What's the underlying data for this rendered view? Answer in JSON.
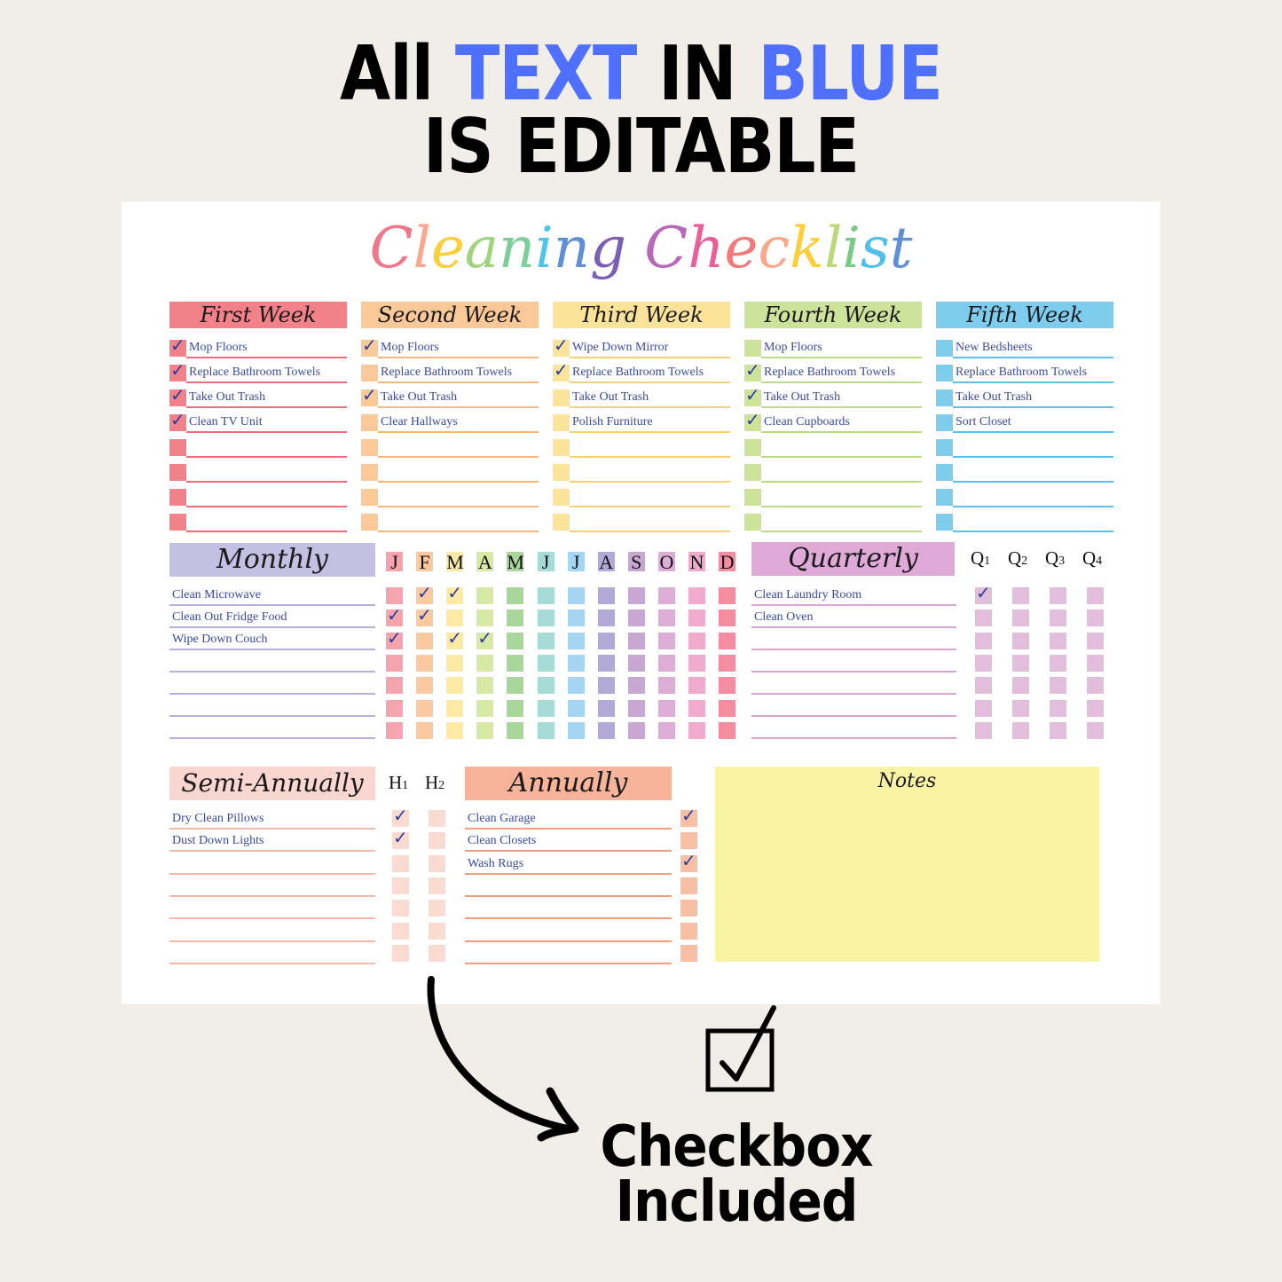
{
  "banner": {
    "line1_pre": "All ",
    "line1_blue1": "TEXT",
    "line1_mid": " IN ",
    "line1_blue2": "BLUE",
    "line2": "IS EDITABLE"
  },
  "title": "Cleaning Checklist",
  "weeks": [
    {
      "title": "First Week",
      "color": "#f2818a",
      "line": "#ee6f7a",
      "items": [
        {
          "text": "Mop Floors",
          "checked": true
        },
        {
          "text": "Replace Bathroom Towels",
          "checked": true
        },
        {
          "text": "Take Out Trash",
          "checked": true
        },
        {
          "text": "Clean TV Unit",
          "checked": true
        },
        {
          "text": "",
          "checked": false
        },
        {
          "text": "",
          "checked": false
        },
        {
          "text": "",
          "checked": false
        },
        {
          "text": "",
          "checked": false
        }
      ]
    },
    {
      "title": "Second Week",
      "color": "#fbc898",
      "line": "#f8b77a",
      "items": [
        {
          "text": "Mop Floors",
          "checked": true
        },
        {
          "text": "Replace Bathroom Towels",
          "checked": false
        },
        {
          "text": "Take Out Trash",
          "checked": true
        },
        {
          "text": "Clear Hallways",
          "checked": false
        },
        {
          "text": "",
          "checked": false
        },
        {
          "text": "",
          "checked": false
        },
        {
          "text": "",
          "checked": false
        },
        {
          "text": "",
          "checked": false
        }
      ]
    },
    {
      "title": "Third Week",
      "color": "#fbe39a",
      "line": "#f6d276",
      "items": [
        {
          "text": "Wipe Down Mirror",
          "checked": true
        },
        {
          "text": "Replace Bathroom Towels",
          "checked": true
        },
        {
          "text": "Take Out Trash",
          "checked": false
        },
        {
          "text": "Polish Furniture",
          "checked": false
        },
        {
          "text": "",
          "checked": false
        },
        {
          "text": "",
          "checked": false
        },
        {
          "text": "",
          "checked": false
        },
        {
          "text": "",
          "checked": false
        }
      ]
    },
    {
      "title": "Fourth Week",
      "color": "#cde39a",
      "line": "#bcdb86",
      "items": [
        {
          "text": "Mop Floors",
          "checked": false
        },
        {
          "text": "Replace Bathroom Towels",
          "checked": true
        },
        {
          "text": "Take Out Trash",
          "checked": true
        },
        {
          "text": "Clean Cupboards",
          "checked": true
        },
        {
          "text": "",
          "checked": false
        },
        {
          "text": "",
          "checked": false
        },
        {
          "text": "",
          "checked": false
        },
        {
          "text": "",
          "checked": false
        }
      ]
    },
    {
      "title": "Fifth Week",
      "color": "#7fcdee",
      "line": "#5cc0ea",
      "items": [
        {
          "text": "New Bedsheets",
          "checked": false
        },
        {
          "text": "Replace Bathroom Towels",
          "checked": false
        },
        {
          "text": "Take Out Trash",
          "checked": false
        },
        {
          "text": "Sort Closet",
          "checked": false
        },
        {
          "text": "",
          "checked": false
        },
        {
          "text": "",
          "checked": false
        },
        {
          "text": "",
          "checked": false
        },
        {
          "text": "",
          "checked": false
        }
      ]
    }
  ],
  "monthly": {
    "title": "Monthly",
    "color": "#c3c0e4",
    "line": "#b5b0dc",
    "items": [
      "Clean Microwave",
      "Clean Out Fridge Food",
      "Wipe Down Couch",
      "",
      "",
      "",
      ""
    ],
    "months": [
      {
        "label": "J",
        "color": "#f5a3ac"
      },
      {
        "label": "F",
        "color": "#fbc9a0"
      },
      {
        "label": "M",
        "color": "#fbe9a4"
      },
      {
        "label": "A",
        "color": "#d7e9a4"
      },
      {
        "label": "M",
        "color": "#a9d69a"
      },
      {
        "label": "J",
        "color": "#a7dcd6"
      },
      {
        "label": "J",
        "color": "#a5d5f2"
      },
      {
        "label": "A",
        "color": "#b2aad6"
      },
      {
        "label": "S",
        "color": "#c7a8d0"
      },
      {
        "label": "O",
        "color": "#dcaed6"
      },
      {
        "label": "N",
        "color": "#f0aacb"
      },
      {
        "label": "D",
        "color": "#f58da2"
      }
    ],
    "checked": [
      [
        false,
        true,
        true,
        false,
        false,
        false,
        false,
        false,
        false,
        false,
        false,
        false
      ],
      [
        true,
        true,
        false,
        false,
        false,
        false,
        false,
        false,
        false,
        false,
        false,
        false
      ],
      [
        true,
        false,
        true,
        true,
        false,
        false,
        false,
        false,
        false,
        false,
        false,
        false
      ],
      [
        false,
        false,
        false,
        false,
        false,
        false,
        false,
        false,
        false,
        false,
        false,
        false
      ],
      [
        false,
        false,
        false,
        false,
        false,
        false,
        false,
        false,
        false,
        false,
        false,
        false
      ],
      [
        false,
        false,
        false,
        false,
        false,
        false,
        false,
        false,
        false,
        false,
        false,
        false
      ],
      [
        false,
        false,
        false,
        false,
        false,
        false,
        false,
        false,
        false,
        false,
        false,
        false
      ]
    ]
  },
  "quarterly": {
    "title": "Quarterly",
    "color": "#dfa9d8",
    "box": "#e2bddc",
    "line": "#d9a6d2",
    "quarters": [
      {
        "q": "Q",
        "n": "1"
      },
      {
        "q": "Q",
        "n": "2"
      },
      {
        "q": "Q",
        "n": "3"
      },
      {
        "q": "Q",
        "n": "4"
      }
    ],
    "items": [
      "Clean Laundry Room",
      "Clean Oven",
      "",
      "",
      "",
      "",
      ""
    ],
    "checked": [
      [
        true,
        false,
        false,
        false
      ],
      [
        false,
        false,
        false,
        false
      ],
      [
        false,
        false,
        false,
        false
      ],
      [
        false,
        false,
        false,
        false
      ],
      [
        false,
        false,
        false,
        false
      ],
      [
        false,
        false,
        false,
        false
      ],
      [
        false,
        false,
        false,
        false
      ]
    ]
  },
  "semi_annually": {
    "title": "Semi-Annually",
    "color": "#fad6d0",
    "box": "#fadbd2",
    "line": "#f3b9a8",
    "halves": [
      {
        "h": "H",
        "n": "1"
      },
      {
        "h": "H",
        "n": "2"
      }
    ],
    "items": [
      "Dry Clean Pillows",
      "Dust Down Lights",
      "",
      "",
      "",
      "",
      ""
    ],
    "checked": [
      [
        true,
        false
      ],
      [
        true,
        false
      ],
      [
        false,
        false
      ],
      [
        false,
        false
      ],
      [
        false,
        false
      ],
      [
        false,
        false
      ],
      [
        false,
        false
      ]
    ]
  },
  "annually": {
    "title": "Annually",
    "color": "#f8b49a",
    "box": "#f9bfa5",
    "line": "#f39e80",
    "items": [
      "Clean Garage",
      "Clean Closets",
      "Wash Rugs",
      "",
      "",
      "",
      ""
    ],
    "checked": [
      true,
      false,
      true,
      false,
      false,
      false,
      false
    ]
  },
  "notes": {
    "title": "Notes",
    "color": "#f9f3a4"
  },
  "callout": {
    "line1": "Checkbox",
    "line2": "Included",
    "icon": "checkbox-icon"
  },
  "title_colors": [
    "#f0768a",
    "#f8a88f",
    "#fbcf3a",
    "#9fd37c",
    "#7dcf9a",
    "#4ec5e8",
    "#5f8fd6",
    "#7a5fb6",
    "#b868b6",
    "#e85f9a",
    "#f27a7a",
    "#f9a98a",
    "#fbcf3a",
    "#bcd97a",
    "#78c98a",
    "#4fc1e8",
    "#5f8fd6"
  ]
}
